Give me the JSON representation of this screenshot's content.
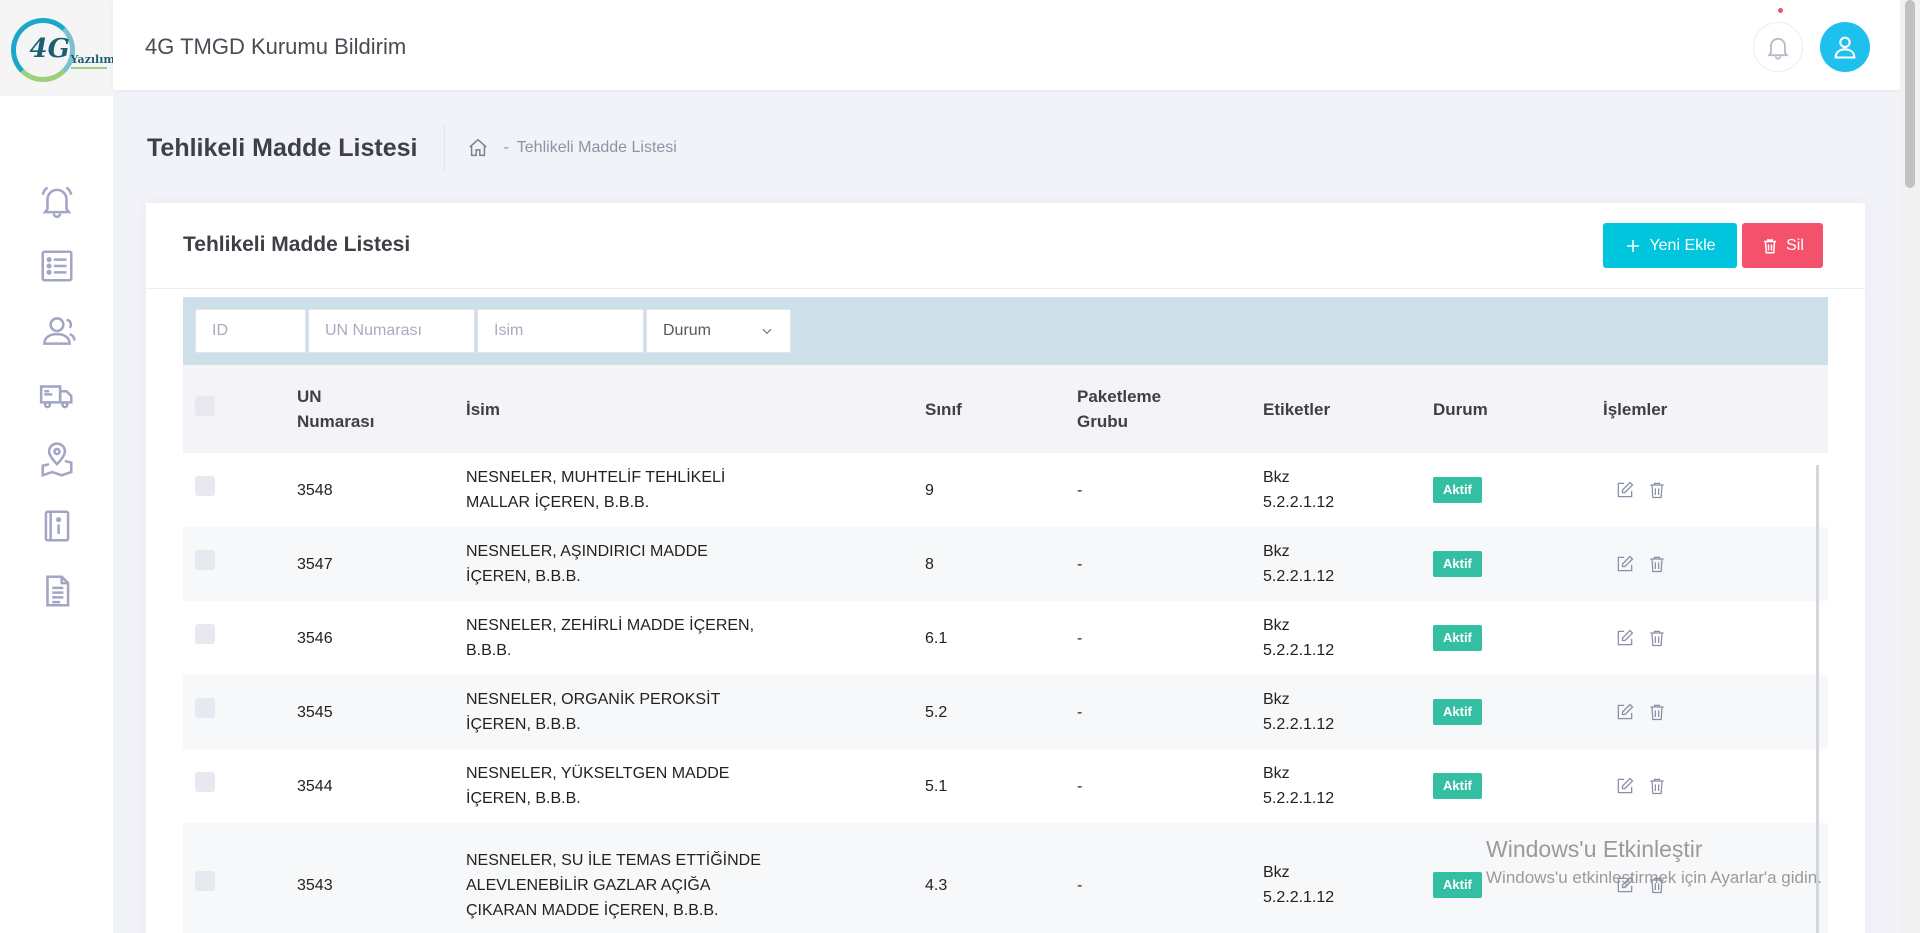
{
  "app": {
    "logo_alt": "4G Yazılım",
    "logo_mark": "4G",
    "logo_text": "Yazılım",
    "title": "4G TMGD Kurumu Bildirim"
  },
  "sidebar": {
    "items": [
      {
        "icon": "bell-ring-icon"
      },
      {
        "icon": "list-icon"
      },
      {
        "icon": "users-icon"
      },
      {
        "icon": "truck-icon"
      },
      {
        "icon": "map-pin-icon"
      },
      {
        "icon": "info-book-icon"
      },
      {
        "icon": "document-icon"
      }
    ]
  },
  "header": {
    "page_title": "Tehlikeli Madde Listesi",
    "breadcrumb": {
      "separator": "-",
      "current": "Tehlikeli Madde Listesi"
    }
  },
  "portlet": {
    "title": "Tehlikeli Madde Listesi",
    "new_button": "Yeni Ekle",
    "delete_button": "Sil"
  },
  "filters": {
    "id_placeholder": "ID",
    "un_placeholder": "UN Numarası",
    "name_placeholder": "İsim",
    "status_selected": "Durum"
  },
  "table": {
    "columns": {
      "un_line1": "UN",
      "un_line2": "Numarası",
      "name": "İsim",
      "class": "Sınıf",
      "packing_line1": "Paketleme",
      "packing_line2": "Grubu",
      "labels": "Etiketler",
      "status": "Durum",
      "actions": "İşlemler"
    },
    "rows": [
      {
        "un": "3548",
        "name": "NESNELER, MUHTELİF TEHLİKELİ MALLAR İÇEREN, B.B.B.",
        "class": "9",
        "packing": "-",
        "labels_line1": "Bkz",
        "labels_line2": "5.2.2.1.12",
        "status": "Aktif"
      },
      {
        "un": "3547",
        "name": "NESNELER, AŞINDIRICI MADDE İÇEREN, B.B.B.",
        "class": "8",
        "packing": "-",
        "labels_line1": "Bkz",
        "labels_line2": "5.2.2.1.12",
        "status": "Aktif"
      },
      {
        "un": "3546",
        "name": "NESNELER, ZEHİRLİ MADDE İÇEREN, B.B.B.",
        "class": "6.1",
        "packing": "-",
        "labels_line1": "Bkz",
        "labels_line2": "5.2.2.1.12",
        "status": "Aktif"
      },
      {
        "un": "3545",
        "name": "NESNELER, ORGANİK PEROKSİT İÇEREN, B.B.B.",
        "class": "5.2",
        "packing": "-",
        "labels_line1": "Bkz",
        "labels_line2": "5.2.2.1.12",
        "status": "Aktif"
      },
      {
        "un": "3544",
        "name": "NESNELER, YÜKSELTGEN MADDE İÇEREN, B.B.B.",
        "class": "5.1",
        "packing": "-",
        "labels_line1": "Bkz",
        "labels_line2": "5.2.2.1.12",
        "status": "Aktif"
      },
      {
        "un": "3543",
        "name": "NESNELER, SU İLE TEMAS ETTİĞİNDE ALEVLENEBİLİR GAZLAR AÇIĞA ÇIKARAN MADDE İÇEREN, B.B.B.",
        "class": "4.3",
        "packing": "-",
        "labels_line1": "Bkz",
        "labels_line2": "5.2.2.1.12",
        "status": "Aktif"
      }
    ]
  },
  "watermark": {
    "line1": "Windows'u Etkinleştir",
    "line2": "Windows'u etkinleştirmek için Ayarlar'a gidin."
  },
  "colors": {
    "accent": "#00c5dc",
    "danger": "#f4516c",
    "success": "#34bfa3",
    "user_avatar": "#1ec0ee",
    "filter_bar": "#cde0ea"
  }
}
